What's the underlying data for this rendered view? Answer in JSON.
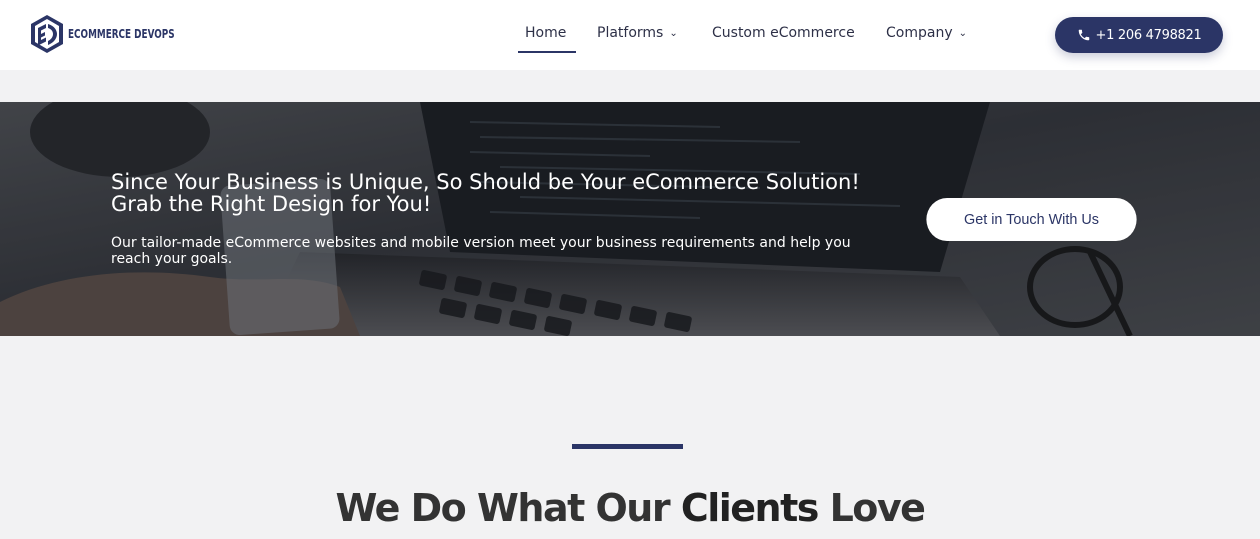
{
  "header": {
    "logo_text": "ECOMMERCE DEVOPS",
    "logo_icon": "ed-monogram-logo",
    "nav": [
      {
        "label": "Home",
        "active": true,
        "has_dropdown": false
      },
      {
        "label": "Platforms",
        "active": false,
        "has_dropdown": true
      },
      {
        "label": "Custom eCommerce",
        "active": false,
        "has_dropdown": false
      },
      {
        "label": "Company",
        "active": false,
        "has_dropdown": true
      }
    ],
    "phone": {
      "icon": "phone-icon",
      "label": "+1 206 4798821"
    }
  },
  "hero": {
    "title": "Since Your Business is Unique, So Should be Your eCommerce Solution! Grab the Right Design for You!",
    "subtitle": "Our tailor-made eCommerce websites and mobile version meet your business requirements and help you reach your goals.",
    "cta_label": "Get in Touch With Us"
  },
  "section": {
    "title_prefix": "We Do What Our ",
    "title_bold": "Clients",
    "title_suffix": " Love"
  },
  "colors": {
    "brand": "#2b3566",
    "page_bg": "#f2f2f3",
    "header_bg": "#ffffff"
  }
}
